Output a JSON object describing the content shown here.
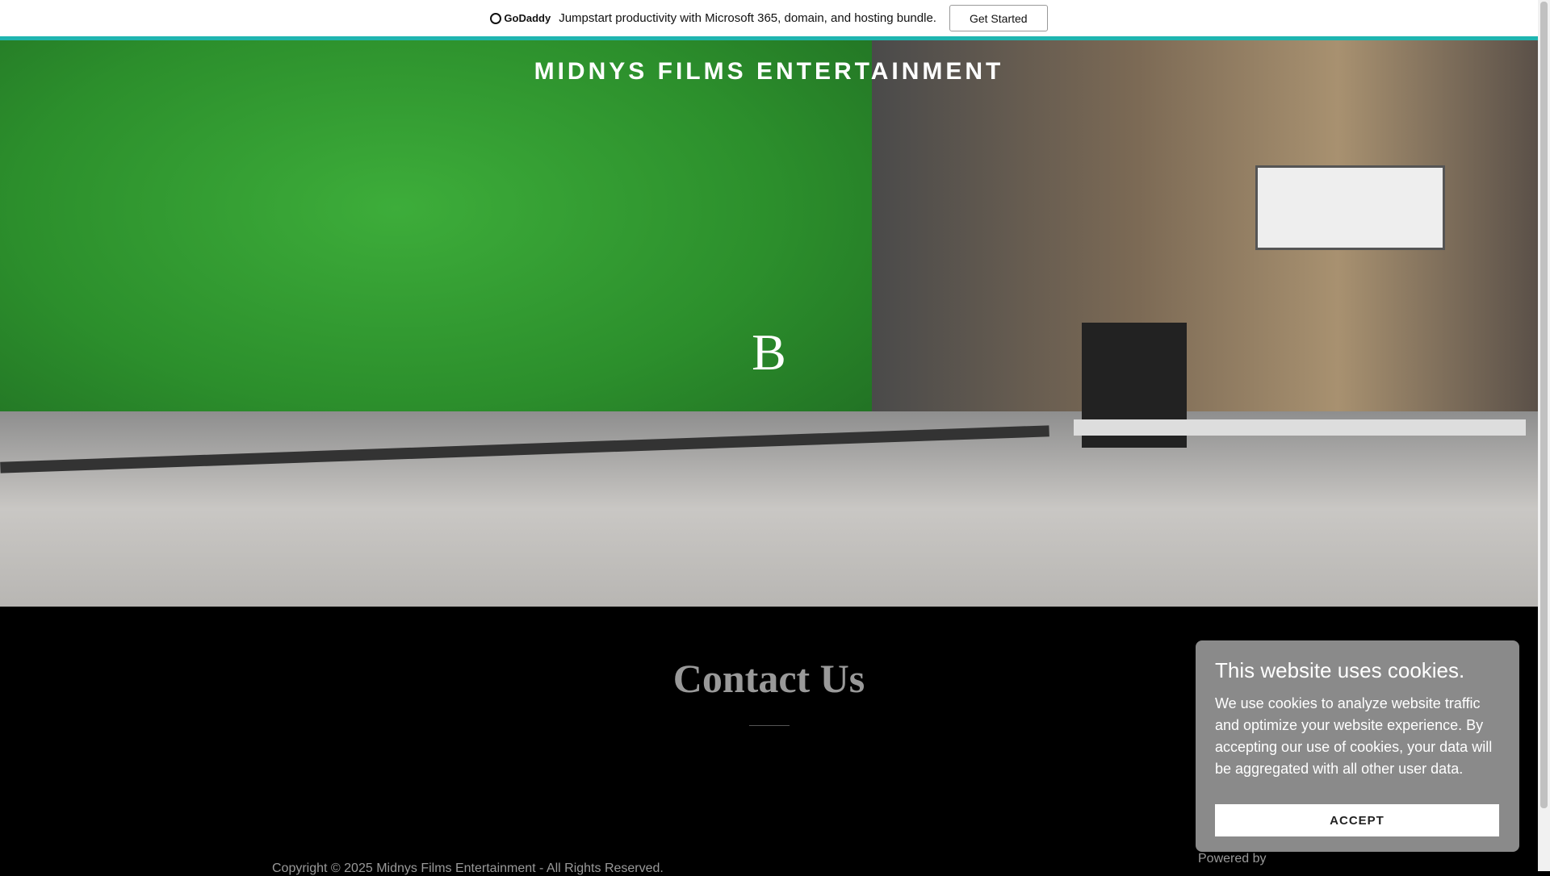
{
  "banner": {
    "logo": "GoDaddy",
    "text": "Jumpstart productivity with Microsoft 365, domain, and hosting bundle.",
    "button": "Get Started"
  },
  "hero": {
    "title": "MIDNYS FILMS ENTERTAINMENT",
    "logo_letter": "B"
  },
  "contact": {
    "heading": "Contact Us"
  },
  "footer": {
    "copyright": "Copyright © 2025 Midnys Films Entertainment - All Rights Reserved.",
    "powered": "Powered by"
  },
  "cookie": {
    "title": "This website uses cookies.",
    "body": "We use cookies to analyze website traffic and optimize your website experience. By accepting our use of cookies, your data will be aggregated with all other user data.",
    "accept": "ACCEPT"
  },
  "colors": {
    "accent": "#1fb5b0"
  }
}
